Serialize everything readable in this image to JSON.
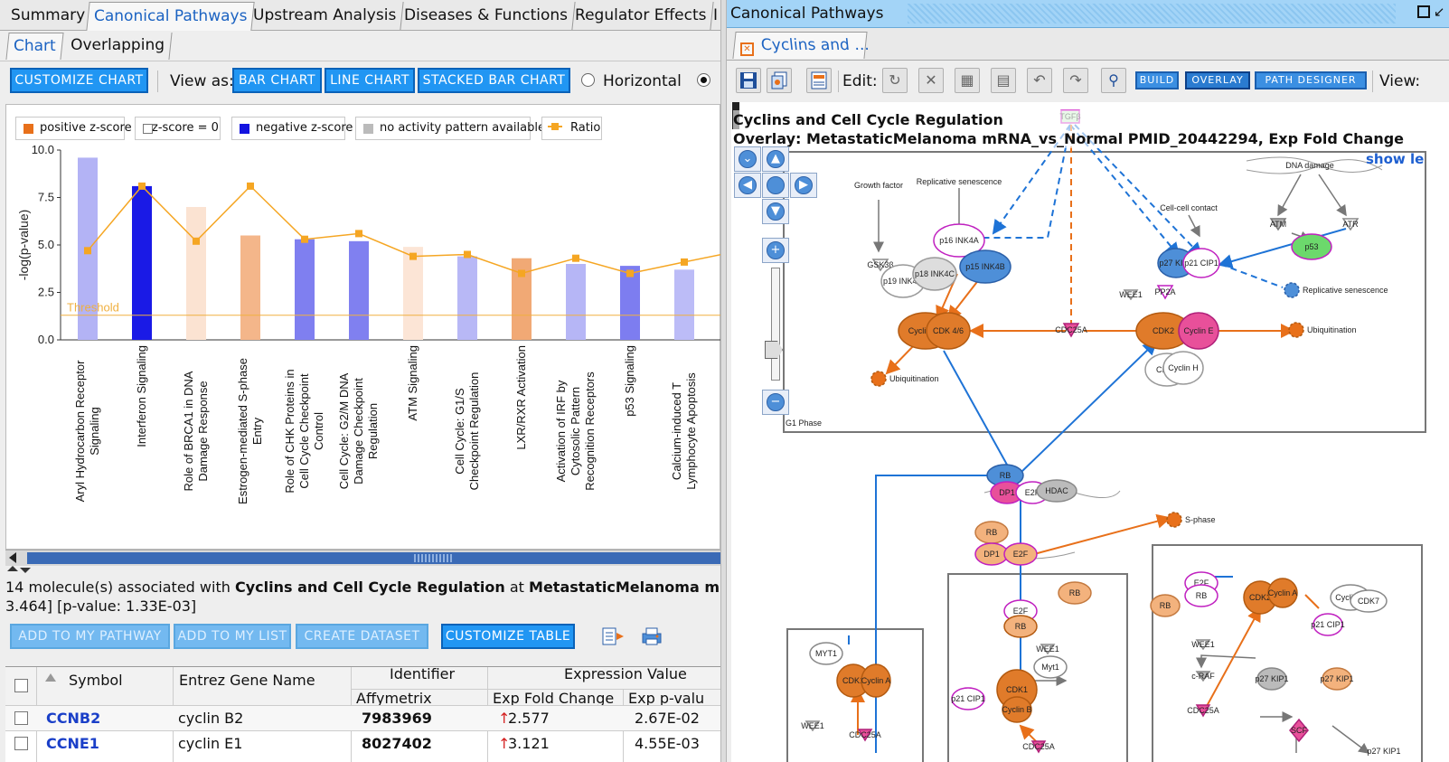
{
  "left_tabs": [
    "Summary",
    "Canonical Pathways",
    "Upstream Analysis",
    "Diseases & Functions",
    "Regulator Effects",
    "I"
  ],
  "left_active_tab": "Canonical Pathways",
  "sub_tabs": [
    "Chart",
    "Overlapping"
  ],
  "toolbar": {
    "customize_chart": "CUSTOMIZE CHART",
    "view_as": "View as:",
    "bar_chart": "BAR CHART",
    "line_chart": "LINE CHART",
    "stacked_bar_chart": "STACKED BAR CHART",
    "horizontal": "Horizontal"
  },
  "legend": [
    "positive z-score",
    "z-score = 0",
    "negative z-score",
    "no activity pattern available",
    "Ratio"
  ],
  "colors": {
    "positive": "#e8701a",
    "zero": "#ffffff",
    "negative": "#1414e0",
    "none": "#bbbbbb",
    "ratio": "#f5a623",
    "accent": "#2196f3",
    "threshold": "#f0b040"
  },
  "chart_data": {
    "type": "bar",
    "ylabel": "-log(p-value)",
    "ylim": [
      0,
      10
    ],
    "yticks": [
      "10.0",
      "7.5",
      "5.0",
      "2.5",
      "0.0"
    ],
    "threshold_label": "Threshold",
    "threshold": 1.3,
    "categories": [
      "Aryl Hydrocarbon Receptor Signaling",
      "Interferon Signaling",
      "Role of BRCA1 in DNA Damage Response",
      "Estrogen-mediated S-phase Entry",
      "Role of CHK Proteins in Cell Cycle Checkpoint Control",
      "Cell Cycle: G2/M DNA Damage Checkpoint Regulation",
      "ATM Signaling",
      "Cell Cycle: G1/S Checkpoint Regulation",
      "LXR/RXR Activation",
      "Activation of IRF by Cytosolic Pattern Recognition Receptors",
      "p53 Signaling",
      "Calcium-induced T Lymphocyte Apoptosis"
    ],
    "values": [
      9.6,
      8.1,
      7.0,
      5.5,
      5.3,
      5.2,
      4.9,
      4.4,
      4.3,
      4.0,
      3.9,
      3.7
    ],
    "bar_colors": [
      "#b3b3f5",
      "#1a1ae6",
      "#fbe3d2",
      "#f4b68a",
      "#7f7ff0",
      "#8080f0",
      "#fce5d6",
      "#b8b8f6",
      "#f1a975",
      "#b6b6f6",
      "#7d7df0",
      "#bcbcf7"
    ],
    "ratio": [
      4.7,
      8.1,
      5.2,
      8.1,
      5.3,
      5.6,
      4.4,
      4.5,
      3.5,
      4.3,
      3.5,
      4.1
    ]
  },
  "info": {
    "prefix": "14 molecule(s) associated with ",
    "pathway": "Cyclins and Cell Cycle Regulation",
    "at": " at ",
    "dataset": "MetastaticMelanoma mR",
    "line2": "3.464] [p-value: 1.33E-03]"
  },
  "table_buttons": [
    "ADD TO MY PATHWAY",
    "ADD TO MY LIST",
    "CREATE DATASET",
    "CUSTOMIZE TABLE"
  ],
  "table": {
    "headers": {
      "symbol": "Symbol",
      "entrez": "Entrez Gene Name",
      "identifier": "Identifier",
      "affymetrix": "Affymetrix",
      "expression": "Expression Value",
      "fold": "Exp Fold Change",
      "pval": "Exp p-valu"
    },
    "rows": [
      {
        "symbol": "CCNB2",
        "name": "cyclin B2",
        "id": "7983969",
        "fold": "2.577",
        "pval": "2.67E-02"
      },
      {
        "symbol": "CCNE1",
        "name": "cyclin E1",
        "id": "8027402",
        "fold": "3.121",
        "pval": "4.55E-03"
      }
    ]
  },
  "right": {
    "title": "Canonical Pathways",
    "tab": "Cyclins and ...",
    "edit": "Edit:",
    "build": "BUILD",
    "overlay": "OVERLAY",
    "path_designer": "PATH DESIGNER",
    "view": "View:",
    "pathway_title": "Cyclins and Cell Cycle Regulation",
    "overlay_line": "Overlay: MetastaticMelanoma mRNA_vs_Normal PMID_20442294, Exp Fold Change",
    "show_legend": "show le",
    "nodes": [
      "TGFβ",
      "Growth factor",
      "Replicative senescence",
      "p16 INK4A",
      "p15 INK4B",
      "GSK3β",
      "p19 INK4D",
      "p18 INK4C",
      "Cyclin D1",
      "CDK 4/6",
      "CDC25A",
      "CDK2",
      "Cyclin E",
      "CDK7",
      "Cyclin H",
      "Ubiquitination",
      "Cell-cell contact",
      "p27 KIP1",
      "p21 CIP1",
      "PP2A",
      "WEE1",
      "DNA damage",
      "ATM",
      "ATR",
      "p53",
      "Replicative senescence",
      "Ubiquitination",
      "G1 Phase",
      "RB",
      "DP1",
      "E2F",
      "HDAC",
      "RB",
      "DP1",
      "E2F",
      "S-phase",
      "E2F",
      "RB",
      "WEE1",
      "Myt1",
      "CDK1",
      "Cyclin B",
      "p21 CIP1",
      "CDC25A",
      "RB",
      "MYT1",
      "CDK1",
      "Cyclin A",
      "WEE1",
      "CDC25A",
      "E2F",
      "RB",
      "RB",
      "CDK2",
      "Cyclin A",
      "Cyclin H",
      "CDK7",
      "p21 CIP1",
      "WEE1",
      "c-RAF",
      "CDC25A",
      "p27 KIP1",
      "p27 KIP1",
      "SCF",
      "p27 KIP1"
    ]
  }
}
